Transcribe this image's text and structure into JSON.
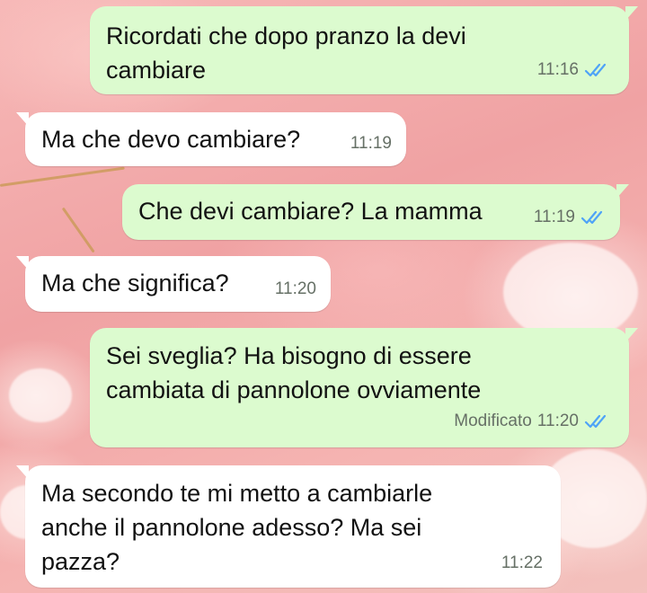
{
  "colors": {
    "outgoing_bubble": "#dcfbcf",
    "incoming_bubble": "#ffffff",
    "read_ticks": "#4fa3f7",
    "wallpaper": "#f2a9aa"
  },
  "messages": [
    {
      "direction": "outgoing",
      "lines": [
        "Ricordati che dopo pranzo la devi",
        "cambiare"
      ],
      "time": "11:16",
      "status_icon": "double-check-read-icon"
    },
    {
      "direction": "incoming",
      "lines": [
        "Ma che devo cambiare?"
      ],
      "time": "11:19"
    },
    {
      "direction": "outgoing",
      "lines": [
        "Che devi cambiare? La mamma"
      ],
      "time": "11:19",
      "status_icon": "double-check-read-icon"
    },
    {
      "direction": "incoming",
      "lines": [
        "Ma che significa?"
      ],
      "time": "11:20"
    },
    {
      "direction": "outgoing",
      "lines": [
        "Sei sveglia? Ha bisogno di essere",
        "cambiata di pannolone ovviamente"
      ],
      "edited_label": "Modificato",
      "time": "11:20",
      "status_icon": "double-check-read-icon"
    },
    {
      "direction": "incoming",
      "lines": [
        "Ma secondo te mi metto a cambiarle",
        "anche il pannolone adesso? Ma sei",
        "pazza?"
      ],
      "time": "11:22"
    }
  ]
}
